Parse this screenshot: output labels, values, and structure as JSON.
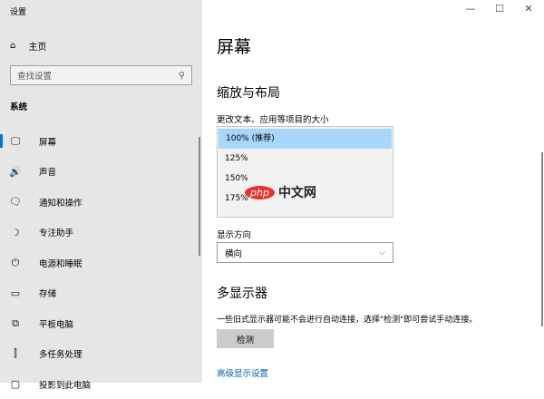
{
  "window": {
    "title": "设置",
    "minimize": "—",
    "maximize": "☐",
    "close": "✕"
  },
  "sidebar": {
    "home": "主页",
    "search_placeholder": "查找设置",
    "section": "系统",
    "items": [
      {
        "label": "屏幕",
        "icon": "monitor-icon",
        "glyph": "🖵"
      },
      {
        "label": "声音",
        "icon": "speaker-icon",
        "glyph": "🔊"
      },
      {
        "label": "通知和操作",
        "icon": "notification-icon",
        "glyph": "🗨"
      },
      {
        "label": "专注助手",
        "icon": "moon-icon",
        "glyph": "☽"
      },
      {
        "label": "电源和睡眠",
        "icon": "power-icon",
        "glyph": "⏻"
      },
      {
        "label": "存储",
        "icon": "storage-icon",
        "glyph": "▭"
      },
      {
        "label": "平板电脑",
        "icon": "tablet-icon",
        "glyph": "⧉"
      },
      {
        "label": "多任务处理",
        "icon": "multitask-icon",
        "glyph": "⫿"
      },
      {
        "label": "投影到此电脑",
        "icon": "project-icon",
        "glyph": "▢"
      }
    ]
  },
  "main": {
    "title": "屏幕",
    "scale_heading": "缩放与布局",
    "scale_label": "更改文本、应用等项目的大小",
    "scale_options": [
      "100% (推荐)",
      "125%",
      "150%",
      "175%"
    ],
    "orientation_label": "显示方向",
    "orientation_value": "横向",
    "multi_heading": "多显示器",
    "multi_desc": "一些旧式显示器可能不会进行自动连接，选择\"检测\"即可尝试手动连接。",
    "detect_button": "检测",
    "advanced_link": "高级显示设置"
  },
  "watermark": {
    "php": "php",
    "text": "中文网"
  }
}
